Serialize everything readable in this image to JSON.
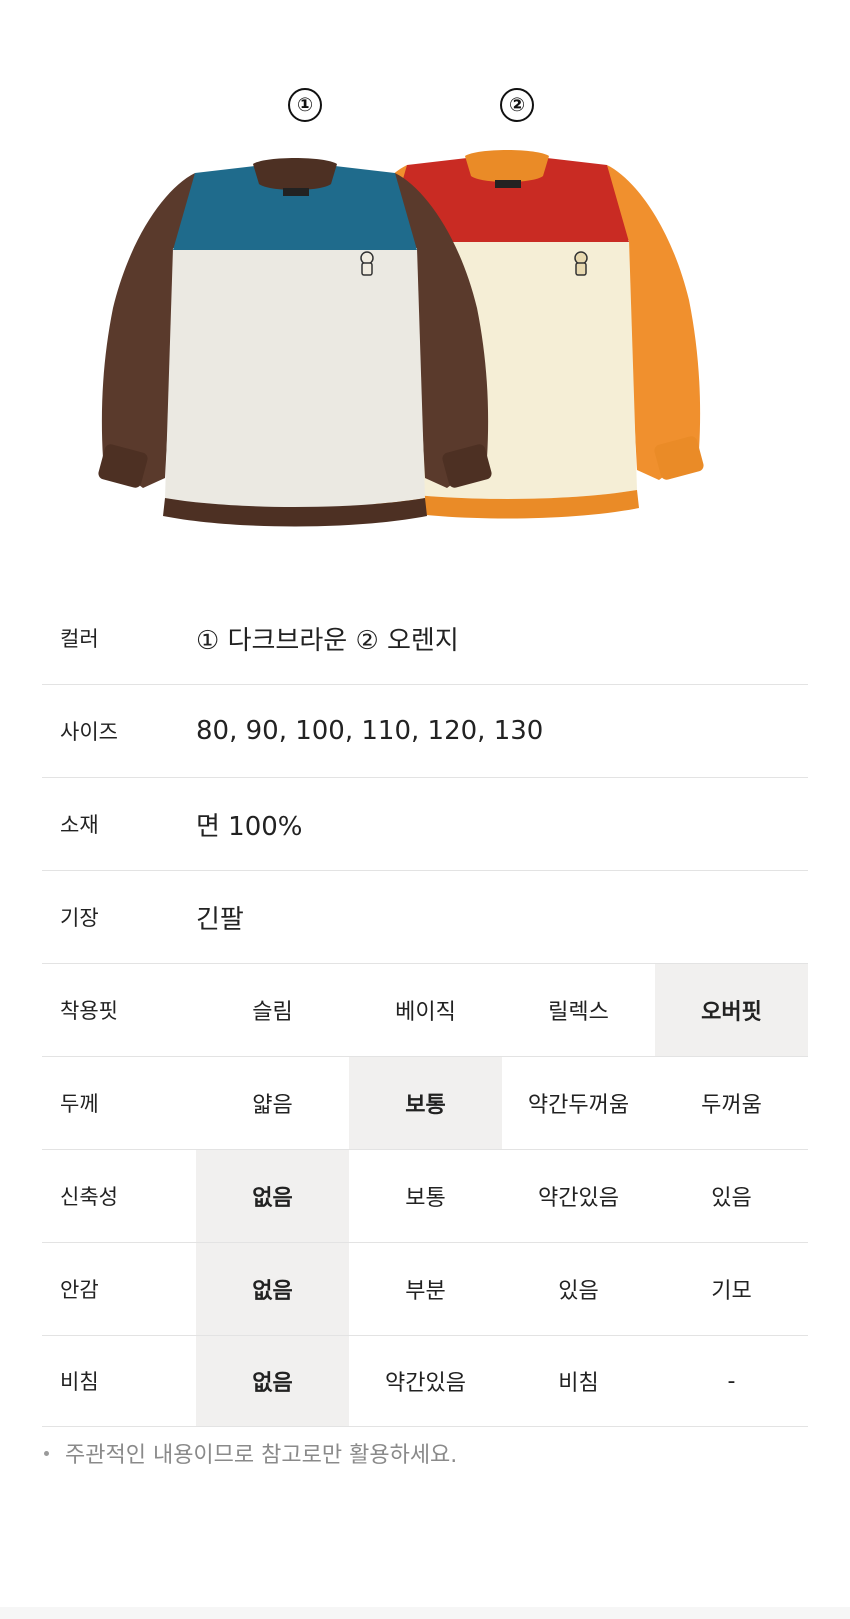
{
  "badges": [
    "①",
    "②"
  ],
  "products": [
    {
      "icon": "brown-color-block-sweatshirt-image",
      "body": "#ebe9e2",
      "yoke": "#1f6b8c",
      "sleeve": "#5a3a2c",
      "trim": "#4d3023"
    },
    {
      "icon": "orange-color-block-sweatshirt-image",
      "body": "#f5eed6",
      "yoke": "#c92b23",
      "sleeve": "#f0902e",
      "trim": "#ea8b27"
    }
  ],
  "specs": {
    "color": {
      "label": "컬러",
      "value": "① 다크브라운 ② 오렌지"
    },
    "size": {
      "label": "사이즈",
      "value": "80,  90,  100, 110,  120,  130"
    },
    "material": {
      "label": "소재",
      "value": "면 100%"
    },
    "length": {
      "label": "기장",
      "value": "긴팔"
    }
  },
  "ratings": {
    "fit": {
      "label": "착용핏",
      "options": [
        "슬림",
        "베이직",
        "릴렉스",
        "오버핏"
      ],
      "selected": 3
    },
    "thickness": {
      "label": "두께",
      "options": [
        "얇음",
        "보통",
        "약간두꺼움",
        "두꺼움"
      ],
      "selected": 1
    },
    "stretch": {
      "label": "신축성",
      "options": [
        "없음",
        "보통",
        "약간있음",
        "있음"
      ],
      "selected": 0
    },
    "lining": {
      "label": "안감",
      "options": [
        "없음",
        "부분",
        "있음",
        "기모"
      ],
      "selected": 0
    },
    "sheer": {
      "label": "비침",
      "options": [
        "없음",
        "약간있음",
        "비침",
        "-"
      ],
      "selected": 0
    }
  },
  "note": "주관적인 내용이므로 참고로만 활용하세요."
}
